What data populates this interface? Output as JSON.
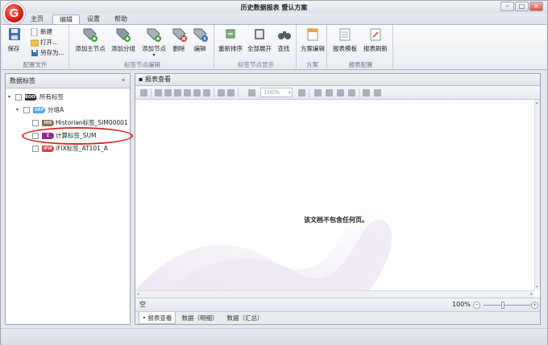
{
  "window": {
    "title": "历史数据报表 暨认方案",
    "minimize": "–",
    "maximize": "□",
    "close": "×",
    "logo_letter": "G"
  },
  "menu": {
    "tabs": [
      "主页",
      "编辑",
      "设置",
      "帮助"
    ],
    "active": "编辑"
  },
  "ribbon": {
    "groups": {
      "config_file": {
        "label": "配置文件",
        "save": "保存",
        "new": "新建",
        "open": "打开...",
        "save_as": "另存为..."
      },
      "tag_node_edit": {
        "label": "标签节点编辑",
        "add_master": "添加主节点",
        "add_group": "添加分组",
        "add_node": "添加节点",
        "delete": "删除",
        "edit": "编辑"
      },
      "tag_node_display": {
        "label": "标签节点显示",
        "resort": "重新排序",
        "expand_all": "全部展开",
        "find": "查找"
      },
      "scheme": {
        "label": "方案",
        "scheme_edit": "方案编辑"
      },
      "report_config": {
        "label": "报表配置",
        "template": "报表模板",
        "refresh": "报表刷新"
      }
    }
  },
  "left_panel": {
    "title": "数据标签",
    "collapse_glyph": "«",
    "tree": [
      {
        "label": "所有标签",
        "tag": "ROOT",
        "tag_color": "#2a2a2a"
      },
      {
        "label": "分组A",
        "tag": "GRP",
        "tag_color": "#4ea6e6"
      },
      {
        "label": "Historian标签_SIM00001",
        "tag": "HIS",
        "tag_color": "#8b6d4c"
      },
      {
        "label": "计算标签_SUM",
        "tag": "Σ",
        "tag_color": "#8a2d8e"
      },
      {
        "label": "iFIX标签_AT101_A",
        "tag": "iFIX",
        "tag_color": "#d64141"
      }
    ]
  },
  "report_view": {
    "title": "报表查看",
    "zoom_combo": "100%",
    "empty_message": "该文档不包含任何页。",
    "status_left": "空",
    "zoom_level": "100%",
    "zoom_minus": "−",
    "zoom_plus": "+",
    "tabs": [
      "报表查看",
      "数据（明细）",
      "数据（汇总）"
    ],
    "active_tab": "报表查看"
  }
}
